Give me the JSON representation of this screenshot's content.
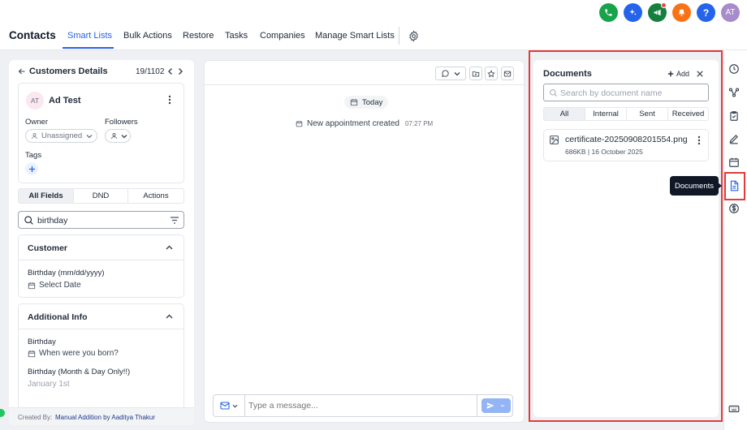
{
  "app": {
    "title": "Contacts"
  },
  "nav": {
    "tabs": [
      "Smart Lists",
      "Bulk Actions",
      "Restore",
      "Tasks",
      "Companies",
      "Manage Smart Lists"
    ],
    "active": "Smart Lists"
  },
  "top_icons": [
    "phone-icon",
    "sparkle-icon",
    "megaphone-icon",
    "bell-icon",
    "help-icon"
  ],
  "help_label": "?",
  "user_avatar": "AT",
  "contact_panel": {
    "title": "Customers Details",
    "position": "19/1102",
    "avatar": "AT",
    "name": "Ad Test",
    "owner_label": "Owner",
    "owner_value": "Unassigned",
    "followers_label": "Followers",
    "tags_label": "Tags",
    "tabs": [
      "All Fields",
      "DND",
      "Actions"
    ],
    "search_value": "birthday",
    "sections": [
      {
        "title": "Customer",
        "fields": [
          {
            "label": "Birthday (mm/dd/yyyy)",
            "value": "Select Date"
          }
        ]
      },
      {
        "title": "Additional Info",
        "fields": [
          {
            "label": "Birthday",
            "value": "When were you born?"
          },
          {
            "label": "Birthday (Month & Day Only!!)",
            "value": "January 1st"
          }
        ]
      }
    ],
    "created_by_label": "Created By:",
    "created_by_value": "Manual Addition by Aaditya Thakur"
  },
  "conversation": {
    "date_chip": "Today",
    "event_text": "New appointment created",
    "event_time": "07:27 PM",
    "message_placeholder": "Type a message..."
  },
  "documents": {
    "title": "Documents",
    "add_label": "Add",
    "search_placeholder": "Search by document name",
    "filter_tabs": [
      "All",
      "Internal",
      "Sent",
      "Received"
    ],
    "active_filter": "All",
    "items": [
      {
        "name": "certificate-20250908201554.png",
        "size": "686KB",
        "date": "16 October 2025"
      }
    ]
  },
  "tooltip": "Documents",
  "colors": {
    "accent": "#2563eb",
    "phone": "#16a34a",
    "sparkle": "#2563eb",
    "megaphone": "#15803d",
    "bell": "#f97316",
    "help": "#2563eb",
    "avatar": "#a78bca",
    "highlight": "#e33a3a"
  }
}
